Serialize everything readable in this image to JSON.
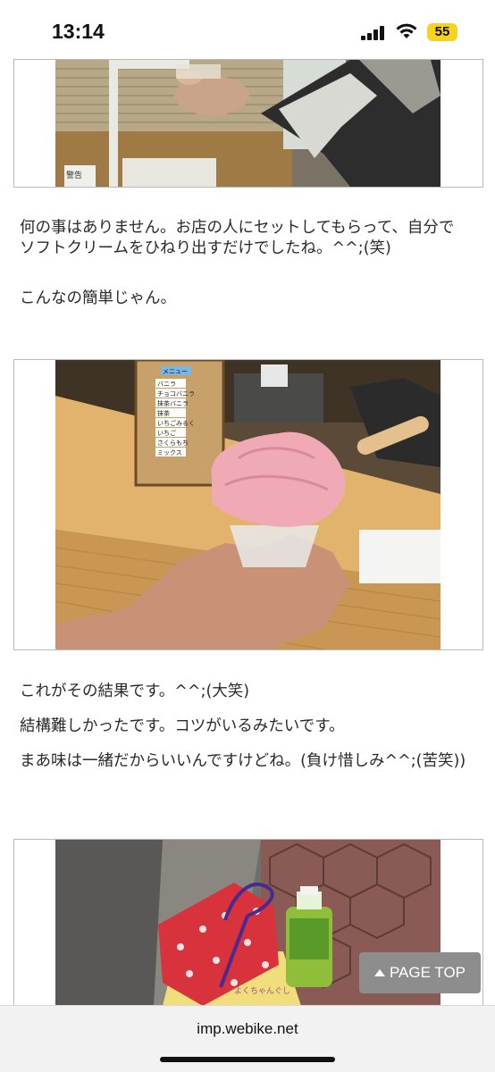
{
  "status_bar": {
    "time": "13:14",
    "battery": "55"
  },
  "article": {
    "paragraphs_1": [
      "何の事はありません。お店の人にセットしてもらって、自分でソフトクリームをひねり出すだけでしたね。^^;(笑)",
      "こんなの簡単じゃん。"
    ],
    "paragraphs_2": [
      "これがその結果です。^^;(大笑)",
      "結構難しかったです。コツがいるみたいです。",
      "まあ味は一緒だからいいんですけどね。(負け惜しみ^^;(苦笑))"
    ],
    "photo1_sign_text": "警告",
    "photo2_menu_title": "メニュー",
    "photo2_menu_items": [
      "バニラ",
      "チョコバニラ",
      "抹茶バニラ",
      "抹茶",
      "いちごみるく",
      "いちご",
      "さくらもち",
      "ミックス"
    ],
    "photo3_box_text": "よくちゃんぐし"
  },
  "page_top": {
    "label": "PAGE TOP"
  },
  "browser": {
    "url": "imp.webike.net"
  },
  "colors": {
    "frame_border": "#b9b9b9",
    "page_top_bg": "#8d8d8d",
    "url_bar_bg": "#f2f2f2",
    "battery": "#f6d323"
  }
}
